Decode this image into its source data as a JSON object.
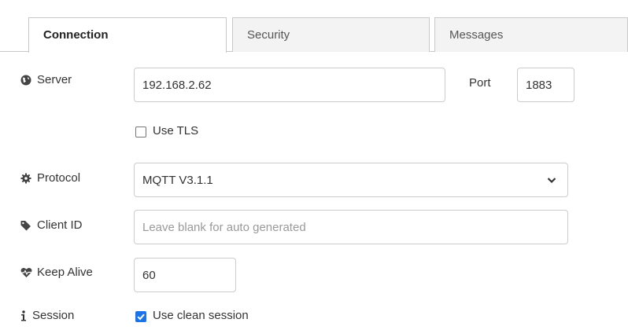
{
  "tabs": [
    {
      "label": "Connection",
      "active": true
    },
    {
      "label": "Security",
      "active": false
    },
    {
      "label": "Messages",
      "active": false
    }
  ],
  "server": {
    "label": "Server",
    "icon": "globe-icon",
    "value": "192.168.2.62"
  },
  "port": {
    "label": "Port",
    "value": "1883"
  },
  "tls": {
    "label": "Use TLS",
    "checked": false
  },
  "protocol": {
    "label": "Protocol",
    "icon": "gear-icon",
    "value": "MQTT V3.1.1"
  },
  "client_id": {
    "label": "Client ID",
    "icon": "tag-icon",
    "value": "",
    "placeholder": "Leave blank for auto generated"
  },
  "keep_alive": {
    "label": "Keep Alive",
    "icon": "heartbeat-icon",
    "value": "60"
  },
  "session": {
    "label": "Session",
    "icon": "info-icon",
    "checkbox_label": "Use clean session",
    "checked": true
  },
  "colors": {
    "accent": "#1a73e8",
    "border": "#cccccc",
    "tab_bg": "#f3f3f3"
  }
}
